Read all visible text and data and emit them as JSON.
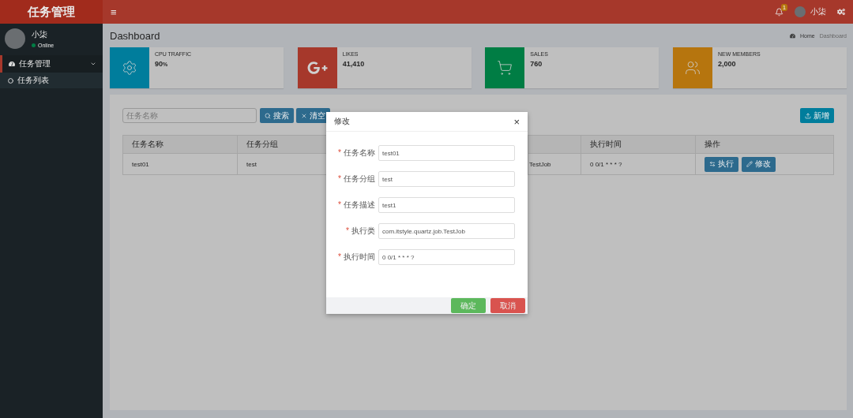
{
  "brand": {
    "title": "任务管理"
  },
  "topbar": {
    "menu_glyph": "≡",
    "notification_badge": "1",
    "user_name": "小柒"
  },
  "sidebar": {
    "user": {
      "name": "小柒",
      "status": "Online"
    },
    "menu": [
      {
        "label": "任务管理",
        "expanded": true,
        "children": [
          {
            "label": "任务列表",
            "selected": true
          }
        ]
      }
    ]
  },
  "page": {
    "title": "Dashboard",
    "breadcrumb": [
      "Home",
      "Dashboard"
    ]
  },
  "stats": [
    {
      "kind": "gear",
      "label": "CPU TRAFFIC",
      "value": "90",
      "unit": "%",
      "color": "#007d9c"
    },
    {
      "kind": "google",
      "label": "LIKES",
      "value": "41,410",
      "color": "#a6382b"
    },
    {
      "kind": "cart",
      "label": "SALES",
      "value": "760",
      "color": "#007d44"
    },
    {
      "kind": "members",
      "label": "NEW MEMBERS",
      "value": "2,000",
      "color": "#b6750e"
    }
  ],
  "toolbar": {
    "search_placeholder": "任务名称",
    "search_button": "搜索",
    "clear_button": "清空",
    "add_button": "新增"
  },
  "table": {
    "columns": [
      {
        "label": "任务名称"
      },
      {
        "label": "任务分组"
      },
      {},
      {},
      {
        "label": "执行时间"
      },
      {
        "label": "操作"
      }
    ],
    "rows": [
      {
        "cells": [
          "test01",
          "test",
          null,
          "TestJob",
          "0 0/1 * * * ?"
        ],
        "actions": [
          "执行",
          "修改"
        ]
      }
    ]
  },
  "modal": {
    "title": "修改",
    "close_glyph": "×",
    "fields": [
      {
        "mark": "*",
        "label": "任务名称",
        "value": "test01"
      },
      {
        "mark": "*",
        "label": "任务分组",
        "value": "test"
      },
      {
        "mark": "*",
        "label": "任务描述",
        "value": "test1"
      },
      {
        "mark": "*",
        "label": "执行类",
        "value": "com.itstyle.quartz.job.TestJob"
      },
      {
        "mark": "*",
        "label": "执行时间",
        "value": "0 0/1 * * * ?"
      }
    ],
    "buttons": [
      {
        "kind": "confirm",
        "label": "确定"
      },
      {
        "kind": "cancel",
        "label": "取消"
      }
    ]
  }
}
